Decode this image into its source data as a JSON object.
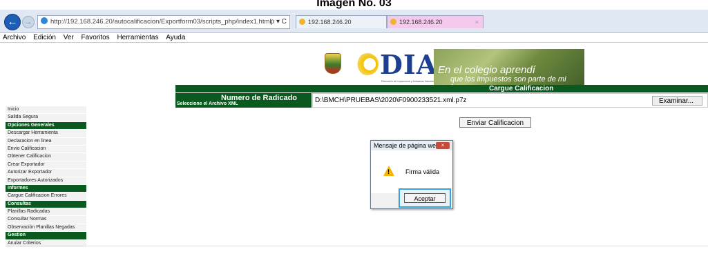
{
  "caption": "Imagen No. 03",
  "browser": {
    "url": "http://192.168.246.20/autocalificacion/Exportform03/scripts_php/index1.html",
    "address_controls": "ρ ▾ C",
    "tabs": [
      {
        "label": "192.168.246.20"
      },
      {
        "label": "192.168.246.20",
        "close": "×"
      }
    ],
    "menu": [
      "Archivo",
      "Edición",
      "Ver",
      "Favoritos",
      "Herramientas",
      "Ayuda"
    ]
  },
  "banner": {
    "logo_text": "DIAN",
    "logo_subtext": "Dirección de Impuestos y Aduanas Nacionales",
    "slogan_line1": "En el colegio aprendí",
    "slogan_line2": "que los impuestos son parte de mi futuro"
  },
  "page": {
    "header_title": "Cargue Calificacion",
    "field_label": "Numero de Radicado",
    "field_sublabel": "Seleccione el Archivo XML",
    "file_value": "D:\\BMCH\\PRUEBAS\\2020\\F0900233521.xml.p7z",
    "browse_label": "Examinar...",
    "send_label": "Enviar Calificacion"
  },
  "sidebar": [
    {
      "type": "item",
      "label": "Inicio"
    },
    {
      "type": "item",
      "label": "Salida Segura"
    },
    {
      "type": "section",
      "label": "Opciones Generales"
    },
    {
      "type": "item",
      "label": "Descargar Herramienta"
    },
    {
      "type": "item",
      "label": "Declaracion en linea"
    },
    {
      "type": "item",
      "label": "Envio Calificacion"
    },
    {
      "type": "item",
      "label": "Obtener Calificacion"
    },
    {
      "type": "item",
      "label": "Crear Exportador"
    },
    {
      "type": "item",
      "label": "Autorizar Exportador"
    },
    {
      "type": "item",
      "label": "Exportadores Autorizados"
    },
    {
      "type": "section",
      "label": "Informes"
    },
    {
      "type": "item",
      "label": "Cargue Calificacion Errores"
    },
    {
      "type": "section",
      "label": "Consultas"
    },
    {
      "type": "item",
      "label": "Planillas Radicadas"
    },
    {
      "type": "item",
      "label": "Consultar Normas"
    },
    {
      "type": "item",
      "label": "Observación Planillas Negadas"
    },
    {
      "type": "section",
      "label": "Gestion"
    },
    {
      "type": "item",
      "label": "Anular Criterios"
    }
  ],
  "dialog": {
    "title": "Mensaje de página web",
    "close": "×",
    "message": "Firma válida",
    "warn_glyph": "!",
    "accept_label": "Aceptar"
  },
  "colors": {
    "accent_green": "#0a5a1f",
    "focus_blue": "#3aa0d8"
  }
}
